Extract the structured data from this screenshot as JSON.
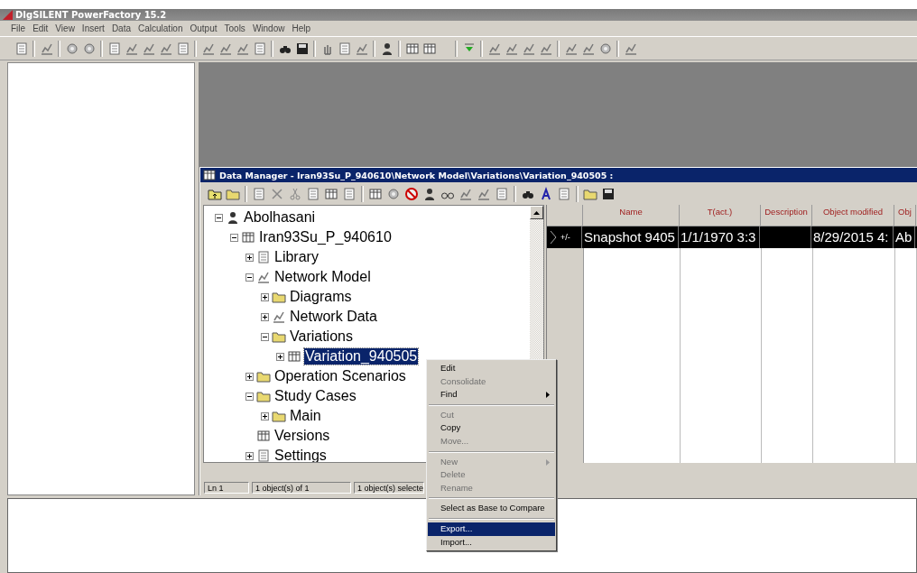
{
  "app": {
    "title": "DIgSILENT PowerFactory 15.2"
  },
  "menu": [
    "File",
    "Edit",
    "View",
    "Insert",
    "Data",
    "Calculation",
    "Output",
    "Tools",
    "Window",
    "Help"
  ],
  "data_manager": {
    "title": "Data Manager - Iran93Su_P_940610\\Network Model\\Variations\\Variation_940505 :",
    "tree": [
      {
        "label": "Abolhasani",
        "kind": "node",
        "expanded": true,
        "selected": false,
        "children": [
          {
            "label": "Iran93Su_P_940610",
            "kind": "node",
            "expanded": true,
            "selected": false,
            "children": [
              {
                "label": "Library",
                "kind": "node",
                "expanded": false,
                "selected": false
              },
              {
                "label": "Network Model",
                "kind": "node",
                "expanded": true,
                "selected": false,
                "children": [
                  {
                    "label": "Diagrams",
                    "kind": "node",
                    "expanded": false,
                    "selected": false
                  },
                  {
                    "label": "Network Data",
                    "kind": "node",
                    "expanded": false,
                    "selected": false
                  },
                  {
                    "label": "Variations",
                    "kind": "node",
                    "expanded": true,
                    "selected": false,
                    "children": [
                      {
                        "label": "Variation_940505",
                        "kind": "node",
                        "expanded": false,
                        "selected": true
                      }
                    ]
                  }
                ]
              },
              {
                "label": "Operation Scenarios",
                "kind": "node",
                "expanded": false,
                "selected": false
              },
              {
                "label": "Study Cases",
                "kind": "node",
                "expanded": true,
                "selected": false,
                "children": [
                  {
                    "label": "Main",
                    "kind": "node",
                    "expanded": false,
                    "selected": false
                  }
                ]
              },
              {
                "label": "Versions",
                "kind": "leaf",
                "selected": false
              },
              {
                "label": "Settings",
                "kind": "node",
                "expanded": false,
                "selected": false
              }
            ]
          }
        ]
      }
    ],
    "table": {
      "columns": [
        "Name",
        "T(act.)",
        "Description",
        "Object modified",
        "Obj"
      ],
      "rows": [
        {
          "marker": "+/-",
          "selected": true,
          "cells": [
            "Snapshot 9405",
            "1/1/1970 3:3",
            null,
            "8/29/2015 4:",
            "Ab"
          ]
        }
      ]
    },
    "status_bar": [
      "Ln 1",
      "1 object(s) of 1",
      "1 object(s) selecte"
    ]
  },
  "context_menu": [
    {
      "kind": "item",
      "label": "Edit",
      "disabled": false,
      "selected": false,
      "submenu": false
    },
    {
      "kind": "item",
      "label": "Consolidate",
      "disabled": true,
      "selected": false,
      "submenu": false
    },
    {
      "kind": "item",
      "label": "Find",
      "disabled": false,
      "selected": false,
      "submenu": true
    },
    {
      "kind": "separator"
    },
    {
      "kind": "item",
      "label": "Cut",
      "disabled": true,
      "selected": false,
      "submenu": false
    },
    {
      "kind": "item",
      "label": "Copy",
      "disabled": false,
      "selected": false,
      "submenu": false
    },
    {
      "kind": "item",
      "label": "Move...",
      "disabled": true,
      "selected": false,
      "submenu": false
    },
    {
      "kind": "separator"
    },
    {
      "kind": "item",
      "label": "New",
      "disabled": true,
      "selected": false,
      "submenu": true
    },
    {
      "kind": "item",
      "label": "Delete",
      "disabled": true,
      "selected": false,
      "submenu": false
    },
    {
      "kind": "item",
      "label": "Rename",
      "disabled": true,
      "selected": false,
      "submenu": false
    },
    {
      "kind": "separator"
    },
    {
      "kind": "item",
      "label": "Select as Base to Compare",
      "disabled": false,
      "selected": false,
      "submenu": false
    },
    {
      "kind": "separator"
    },
    {
      "kind": "item",
      "label": "Export...",
      "disabled": false,
      "selected": true,
      "submenu": false
    },
    {
      "kind": "item",
      "label": "Import...",
      "disabled": false,
      "selected": false,
      "submenu": false
    }
  ]
}
